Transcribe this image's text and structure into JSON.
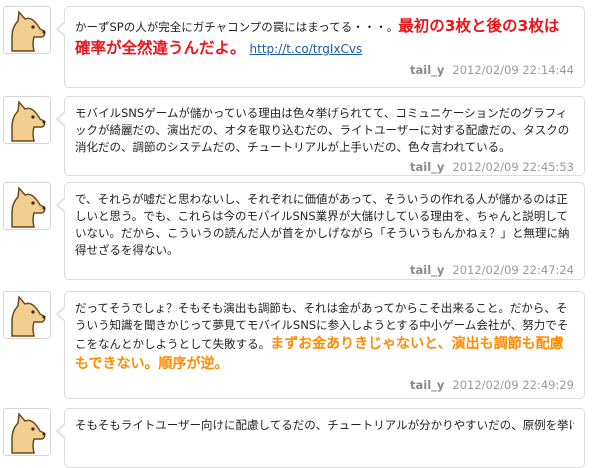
{
  "tweets": [
    {
      "text_before": "かーずSPの人が完全にガチャコンプの罠にはまってる・・・。",
      "highlight": "最初の3枚と後の3枚は確率が全然違うんだよ。",
      "link": "http://t.co/trgIxCvs",
      "user": "tail_y",
      "timestamp": "2012/02/09 22:14:44"
    },
    {
      "text_before": "モバイルSNSゲームが儲かっている理由は色々挙げられてて、コミュニケーションだのグラフィックが綺麗だの、演出だの、オタを取り込むだの、ライトユーザーに対する配慮だの、タスクの消化だの、調節のシステムだの、チュートリアルが上手いだの、色々言われている。",
      "user": "tail_y",
      "timestamp": "2012/02/09 22:45:53"
    },
    {
      "text_before": "で、それらが嘘だと思わないし、それぞれに価値があって、そういうの作れる人が儲かるのは正しいと思う。でも、これらは今のモバイルSNS業界が大儲けしている理由を、ちゃんと説明していない。だから、こういうの読んだ人が首をかしげながら「そういうもんかねぇ？」と無理に納得せざるを得ない。",
      "user": "tail_y",
      "timestamp": "2012/02/09 22:47:24"
    },
    {
      "text_before": "だってそうでしょ？そもそも演出も調節も、それは金があってからこそ出来ること。だから、そういう知識を聞きかじって夢見てモバイルSNSに参入しようとする中小ゲーム会社が、努力でそこをなんとかしようとして失敗する。",
      "highlight": "まずお金ありきじゃないと、演出も調節も配慮もできない。順序が逆。",
      "user": "tail_y",
      "timestamp": "2012/02/09 22:49:29"
    },
    {
      "text_before": "そもそもライトユーザー向けに配慮してるだの、チュートリアルが分かりやすいだの、原例を挙げ"
    }
  ]
}
